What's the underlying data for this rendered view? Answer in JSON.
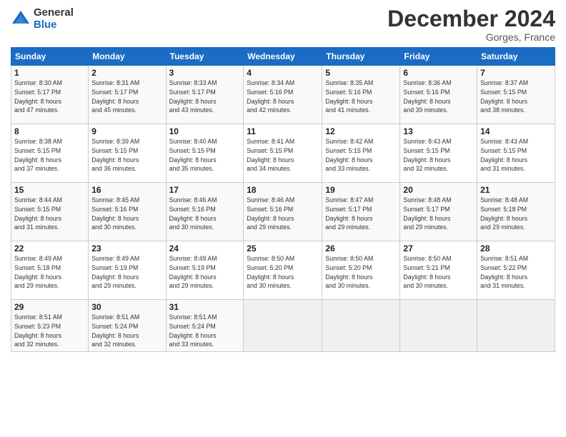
{
  "logo": {
    "general": "General",
    "blue": "Blue"
  },
  "title": "December 2024",
  "subtitle": "Gorges, France",
  "days_of_week": [
    "Sunday",
    "Monday",
    "Tuesday",
    "Wednesday",
    "Thursday",
    "Friday",
    "Saturday"
  ],
  "weeks": [
    [
      {
        "day": "1",
        "sunrise": "Sunrise: 8:30 AM",
        "sunset": "Sunset: 5:17 PM",
        "daylight": "Daylight: 8 hours and 47 minutes."
      },
      {
        "day": "2",
        "sunrise": "Sunrise: 8:31 AM",
        "sunset": "Sunset: 5:17 PM",
        "daylight": "Daylight: 8 hours and 45 minutes."
      },
      {
        "day": "3",
        "sunrise": "Sunrise: 8:33 AM",
        "sunset": "Sunset: 5:17 PM",
        "daylight": "Daylight: 8 hours and 43 minutes."
      },
      {
        "day": "4",
        "sunrise": "Sunrise: 8:34 AM",
        "sunset": "Sunset: 5:16 PM",
        "daylight": "Daylight: 8 hours and 42 minutes."
      },
      {
        "day": "5",
        "sunrise": "Sunrise: 8:35 AM",
        "sunset": "Sunset: 5:16 PM",
        "daylight": "Daylight: 8 hours and 41 minutes."
      },
      {
        "day": "6",
        "sunrise": "Sunrise: 8:36 AM",
        "sunset": "Sunset: 5:16 PM",
        "daylight": "Daylight: 8 hours and 39 minutes."
      },
      {
        "day": "7",
        "sunrise": "Sunrise: 8:37 AM",
        "sunset": "Sunset: 5:15 PM",
        "daylight": "Daylight: 8 hours and 38 minutes."
      }
    ],
    [
      {
        "day": "8",
        "sunrise": "Sunrise: 8:38 AM",
        "sunset": "Sunset: 5:15 PM",
        "daylight": "Daylight: 8 hours and 37 minutes."
      },
      {
        "day": "9",
        "sunrise": "Sunrise: 8:39 AM",
        "sunset": "Sunset: 5:15 PM",
        "daylight": "Daylight: 8 hours and 36 minutes."
      },
      {
        "day": "10",
        "sunrise": "Sunrise: 8:40 AM",
        "sunset": "Sunset: 5:15 PM",
        "daylight": "Daylight: 8 hours and 35 minutes."
      },
      {
        "day": "11",
        "sunrise": "Sunrise: 8:41 AM",
        "sunset": "Sunset: 5:15 PM",
        "daylight": "Daylight: 8 hours and 34 minutes."
      },
      {
        "day": "12",
        "sunrise": "Sunrise: 8:42 AM",
        "sunset": "Sunset: 5:15 PM",
        "daylight": "Daylight: 8 hours and 33 minutes."
      },
      {
        "day": "13",
        "sunrise": "Sunrise: 8:43 AM",
        "sunset": "Sunset: 5:15 PM",
        "daylight": "Daylight: 8 hours and 32 minutes."
      },
      {
        "day": "14",
        "sunrise": "Sunrise: 8:43 AM",
        "sunset": "Sunset: 5:15 PM",
        "daylight": "Daylight: 8 hours and 31 minutes."
      }
    ],
    [
      {
        "day": "15",
        "sunrise": "Sunrise: 8:44 AM",
        "sunset": "Sunset: 5:15 PM",
        "daylight": "Daylight: 8 hours and 31 minutes."
      },
      {
        "day": "16",
        "sunrise": "Sunrise: 8:45 AM",
        "sunset": "Sunset: 5:16 PM",
        "daylight": "Daylight: 8 hours and 30 minutes."
      },
      {
        "day": "17",
        "sunrise": "Sunrise: 8:46 AM",
        "sunset": "Sunset: 5:16 PM",
        "daylight": "Daylight: 8 hours and 30 minutes."
      },
      {
        "day": "18",
        "sunrise": "Sunrise: 8:46 AM",
        "sunset": "Sunset: 5:16 PM",
        "daylight": "Daylight: 8 hours and 29 minutes."
      },
      {
        "day": "19",
        "sunrise": "Sunrise: 8:47 AM",
        "sunset": "Sunset: 5:17 PM",
        "daylight": "Daylight: 8 hours and 29 minutes."
      },
      {
        "day": "20",
        "sunrise": "Sunrise: 8:48 AM",
        "sunset": "Sunset: 5:17 PM",
        "daylight": "Daylight: 8 hours and 29 minutes."
      },
      {
        "day": "21",
        "sunrise": "Sunrise: 8:48 AM",
        "sunset": "Sunset: 5:18 PM",
        "daylight": "Daylight: 8 hours and 29 minutes."
      }
    ],
    [
      {
        "day": "22",
        "sunrise": "Sunrise: 8:49 AM",
        "sunset": "Sunset: 5:18 PM",
        "daylight": "Daylight: 8 hours and 29 minutes."
      },
      {
        "day": "23",
        "sunrise": "Sunrise: 8:49 AM",
        "sunset": "Sunset: 5:19 PM",
        "daylight": "Daylight: 8 hours and 29 minutes."
      },
      {
        "day": "24",
        "sunrise": "Sunrise: 8:49 AM",
        "sunset": "Sunset: 5:19 PM",
        "daylight": "Daylight: 8 hours and 29 minutes."
      },
      {
        "day": "25",
        "sunrise": "Sunrise: 8:50 AM",
        "sunset": "Sunset: 5:20 PM",
        "daylight": "Daylight: 8 hours and 30 minutes."
      },
      {
        "day": "26",
        "sunrise": "Sunrise: 8:50 AM",
        "sunset": "Sunset: 5:20 PM",
        "daylight": "Daylight: 8 hours and 30 minutes."
      },
      {
        "day": "27",
        "sunrise": "Sunrise: 8:50 AM",
        "sunset": "Sunset: 5:21 PM",
        "daylight": "Daylight: 8 hours and 30 minutes."
      },
      {
        "day": "28",
        "sunrise": "Sunrise: 8:51 AM",
        "sunset": "Sunset: 5:22 PM",
        "daylight": "Daylight: 8 hours and 31 minutes."
      }
    ],
    [
      {
        "day": "29",
        "sunrise": "Sunrise: 8:51 AM",
        "sunset": "Sunset: 5:23 PM",
        "daylight": "Daylight: 8 hours and 32 minutes."
      },
      {
        "day": "30",
        "sunrise": "Sunrise: 8:51 AM",
        "sunset": "Sunset: 5:24 PM",
        "daylight": "Daylight: 8 hours and 32 minutes."
      },
      {
        "day": "31",
        "sunrise": "Sunrise: 8:51 AM",
        "sunset": "Sunset: 5:24 PM",
        "daylight": "Daylight: 8 hours and 33 minutes."
      },
      null,
      null,
      null,
      null
    ]
  ]
}
